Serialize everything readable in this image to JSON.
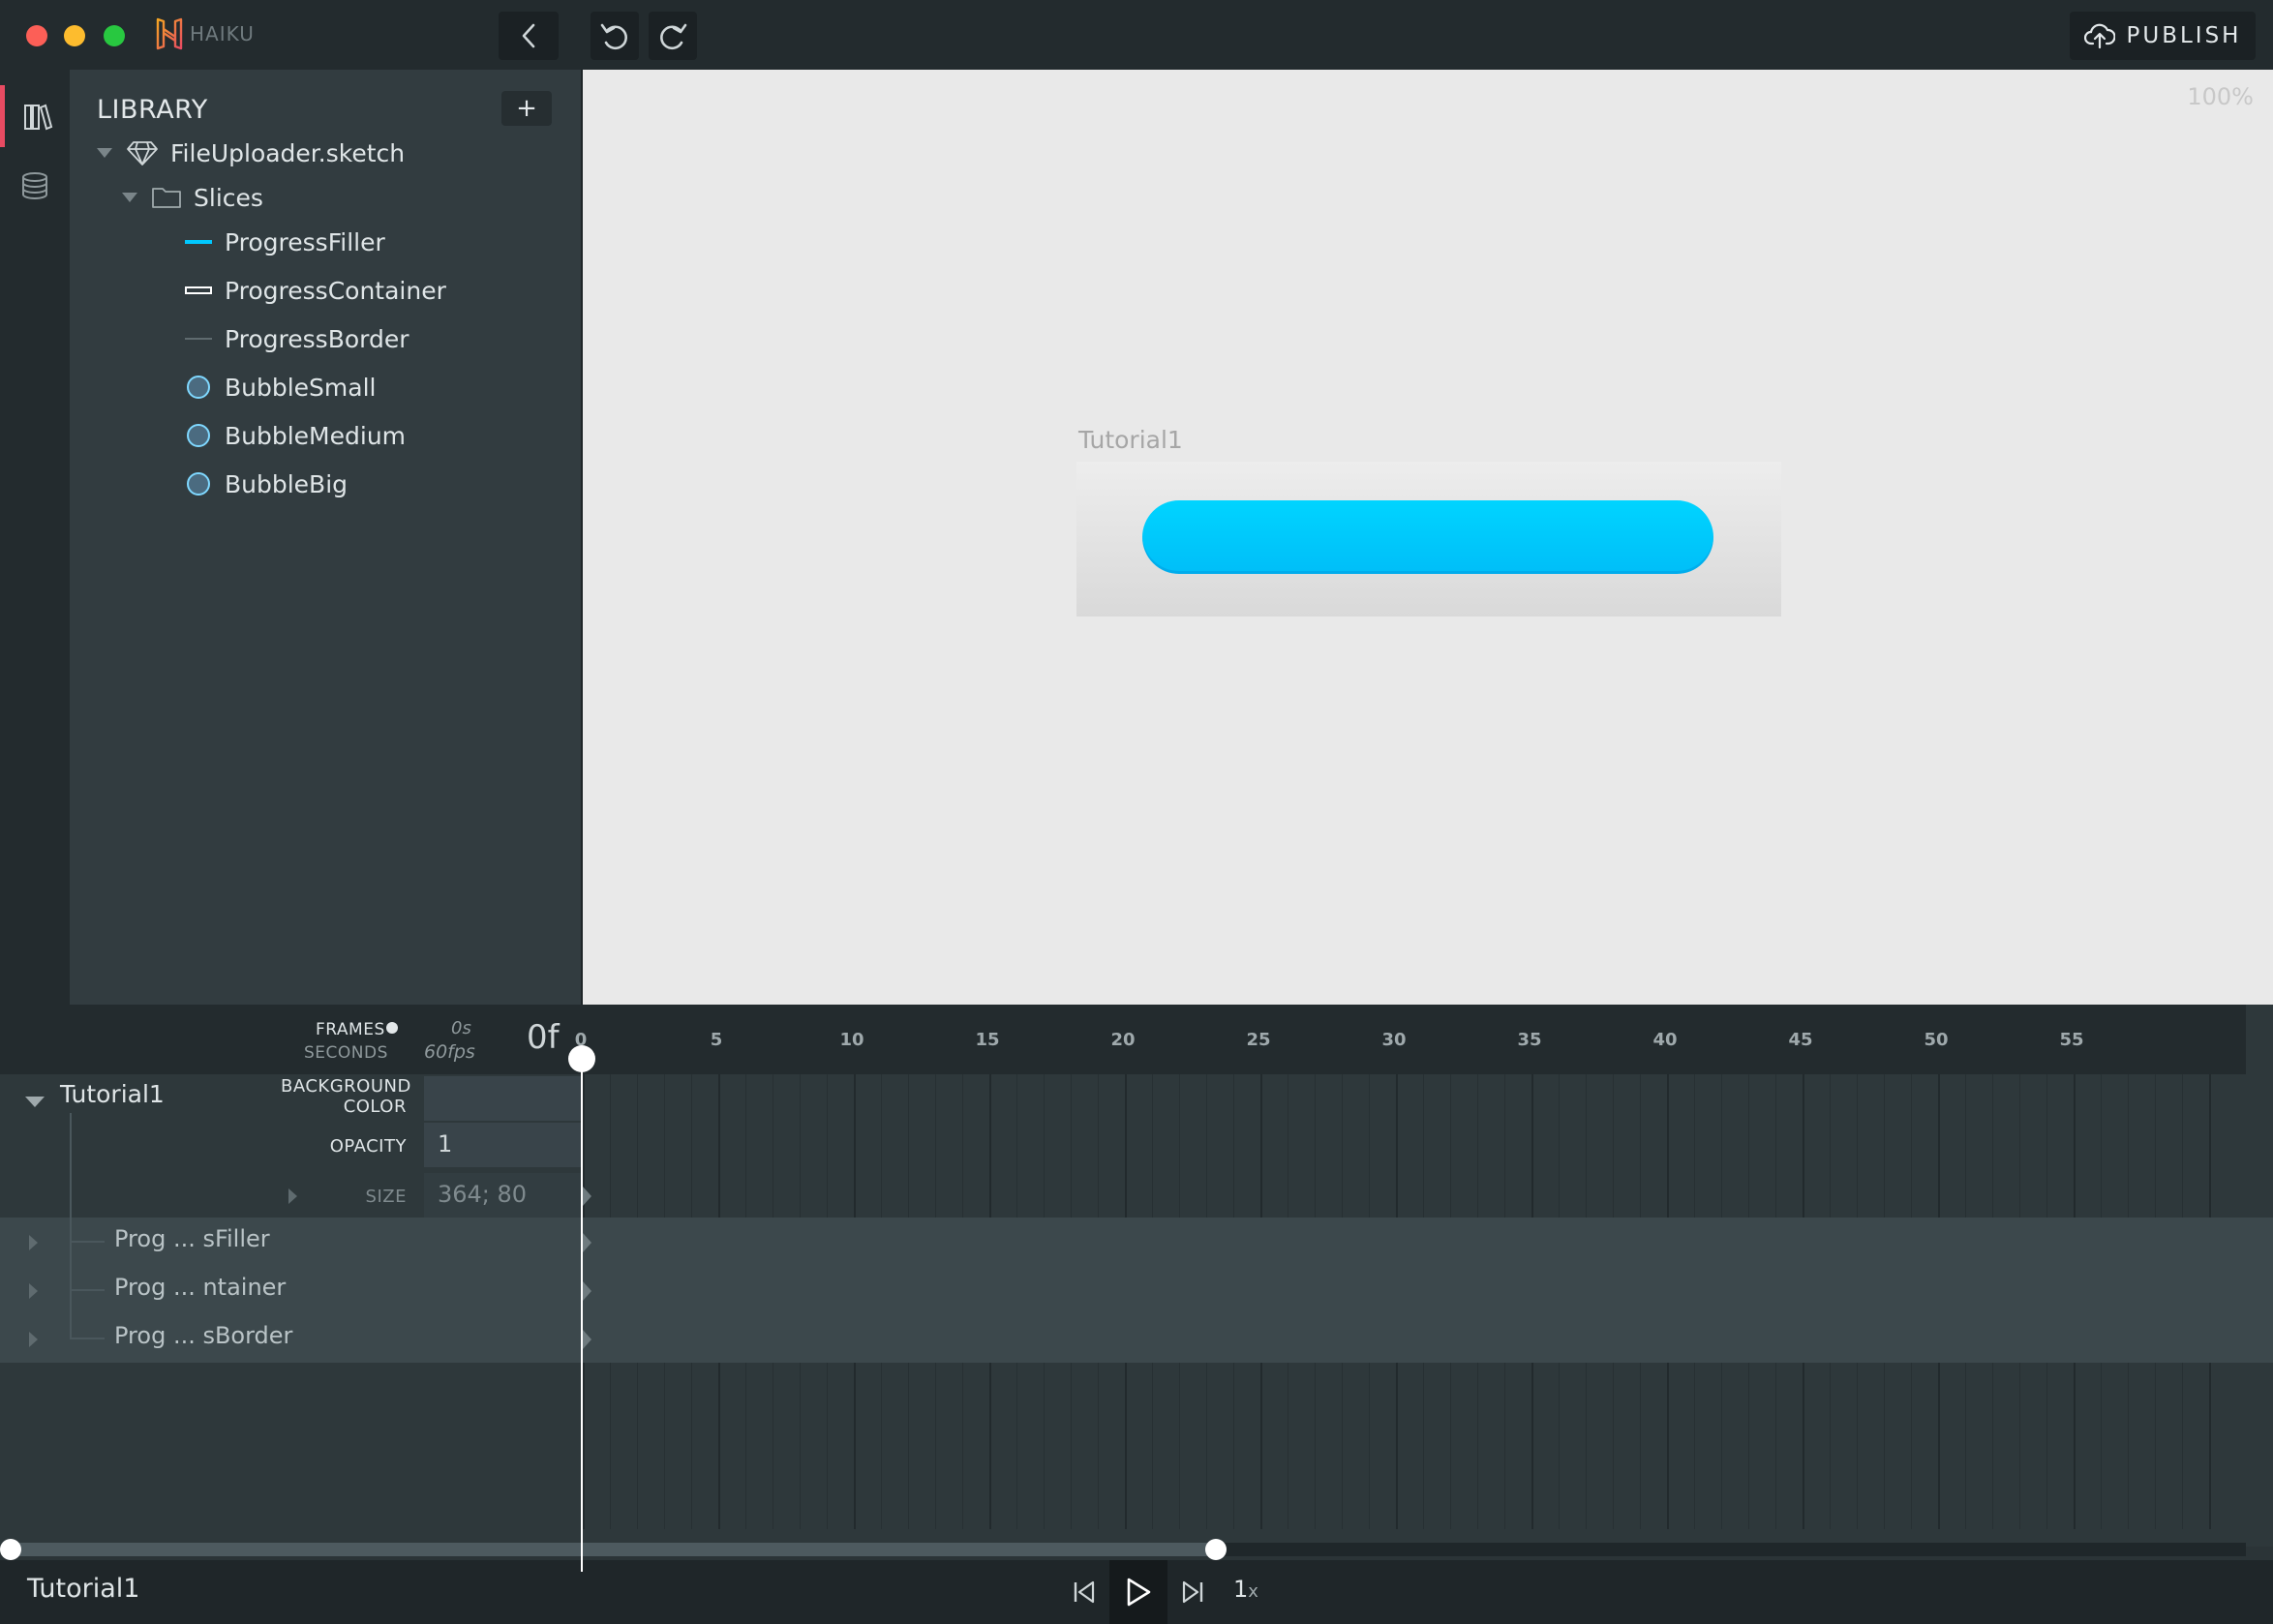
{
  "app": {
    "brand": "HAIKU",
    "publish_label": "PUBLISH"
  },
  "library": {
    "title": "LIBRARY",
    "add_label": "+",
    "file": "FileUploader.sketch",
    "folder": "Slices",
    "items": [
      {
        "label": "ProgressFiller",
        "icon": "line-cyan-icon"
      },
      {
        "label": "ProgressContainer",
        "icon": "rect-outline-icon"
      },
      {
        "label": "ProgressBorder",
        "icon": "line-gray-icon"
      },
      {
        "label": "BubbleSmall",
        "icon": "circle-icon"
      },
      {
        "label": "BubbleMedium",
        "icon": "circle-icon"
      },
      {
        "label": "BubbleBig",
        "icon": "circle-icon"
      }
    ]
  },
  "stage": {
    "zoom": "100%",
    "artboard_label": "Tutorial1",
    "accent": "#00c8ff"
  },
  "timeline": {
    "frames_label": "FRAMES",
    "seconds_label": "SECONDS",
    "seconds_value": "0s",
    "fps": "60fps",
    "current_frame": "0f",
    "ticks": [
      "0",
      "5",
      "10",
      "15",
      "20",
      "25",
      "30",
      "35",
      "40",
      "45",
      "50",
      "55"
    ],
    "component": "Tutorial1",
    "props": {
      "bg_label_1": "BACKGROUND",
      "bg_label_2": "COLOR",
      "opacity_label": "OPACITY",
      "opacity_value": "1",
      "size_label": "SIZE",
      "size_value": "364; 80"
    },
    "layers": [
      "Prog ... sFiller",
      "Prog ... ntainer",
      "Prog ... sBorder"
    ]
  },
  "footer": {
    "component_name": "Tutorial1",
    "speed": "1",
    "speed_suffix": "x"
  }
}
